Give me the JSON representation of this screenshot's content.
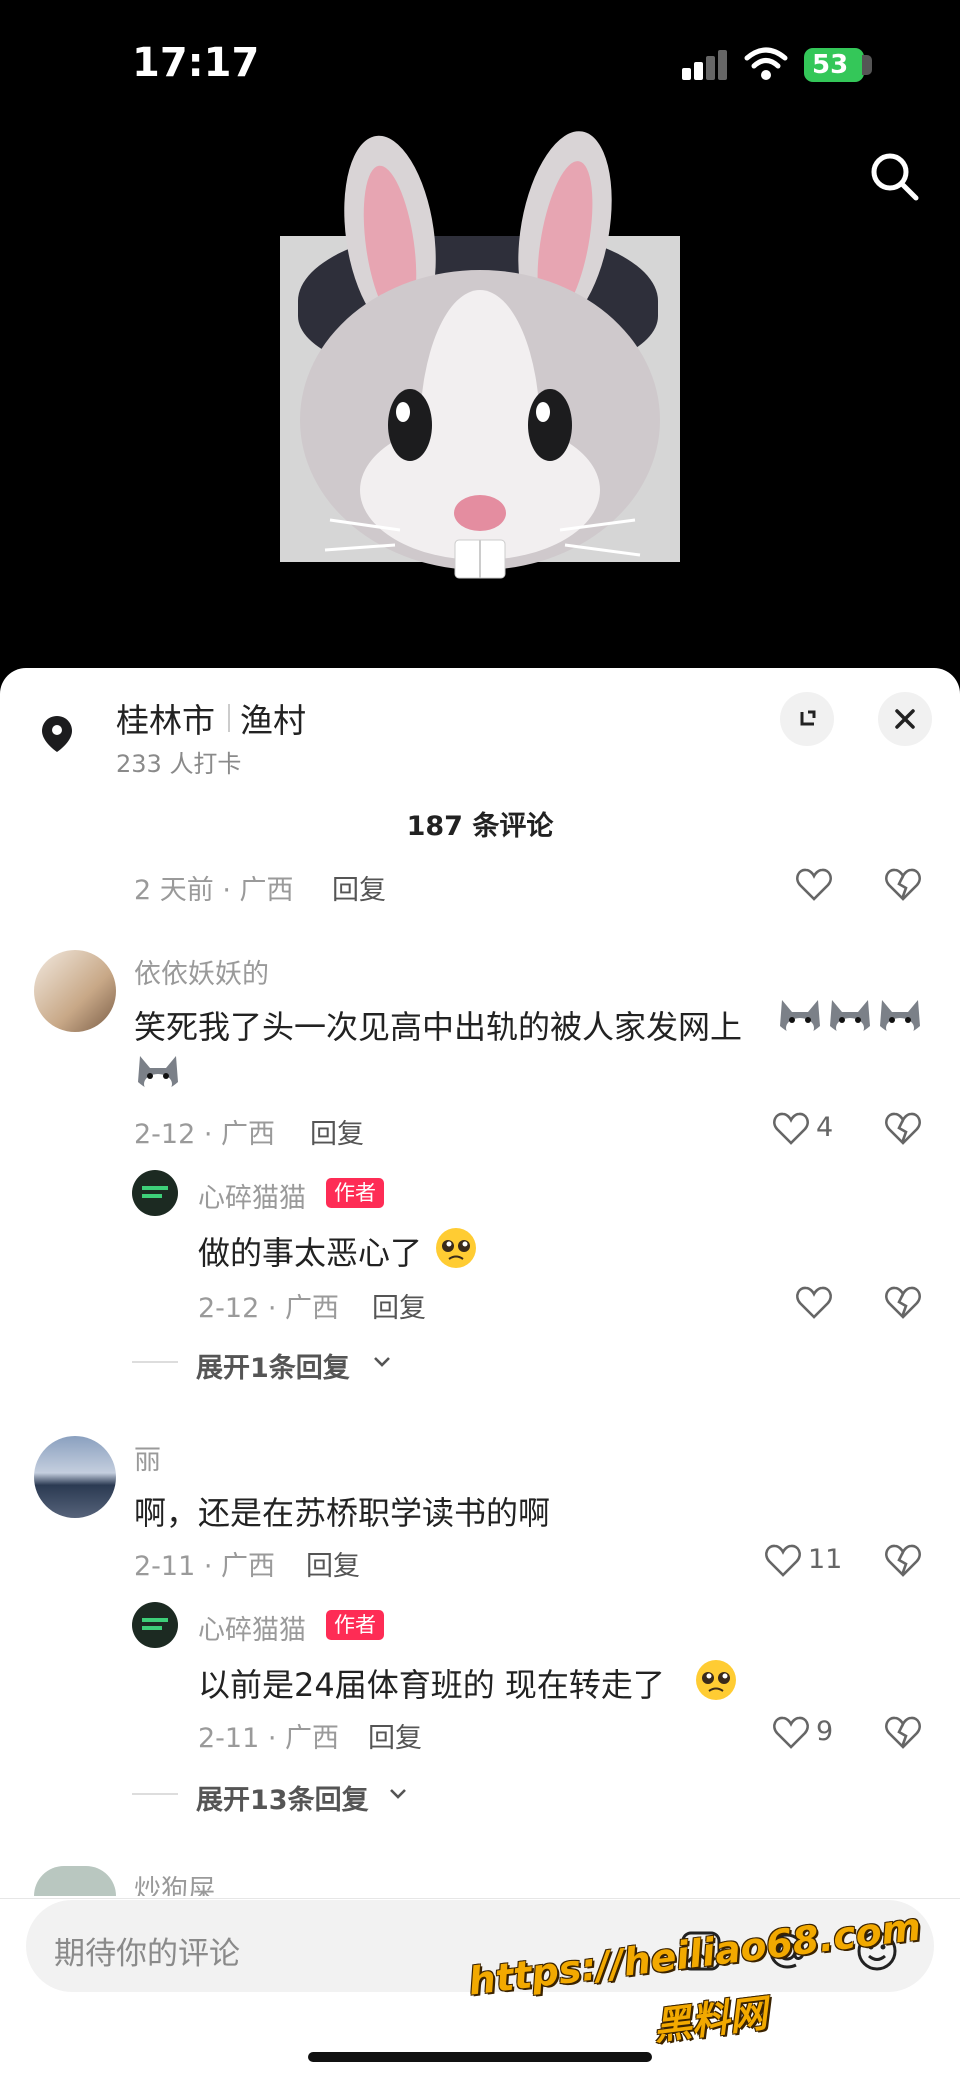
{
  "status_bar": {
    "time": "17:17",
    "battery": "53"
  },
  "location": {
    "city": "桂林市",
    "place": "渔村",
    "checkins": "233 人打卡"
  },
  "comments_count": "187 条评论",
  "prev_comment_meta": {
    "time": "2 天前 · 广西",
    "reply": "回复"
  },
  "comments": [
    {
      "user": "依依妖妖的",
      "text_line1": "笑死我了头一次见高中出轨的被人家发网上",
      "meta": "2-12 · 广西",
      "reply": "回复",
      "likes": "4",
      "author_reply": {
        "user": "心碎猫猫",
        "badge": "作者",
        "text": "做的事太恶心了",
        "meta": "2-12 · 广西",
        "reply": "回复"
      },
      "expand": "展开1条回复"
    },
    {
      "user": "丽",
      "text_line1": "啊，还是在苏桥职学读书的啊",
      "meta": "2-11 · 广西",
      "reply": "回复",
      "likes": "11",
      "author_reply": {
        "user": "心碎猫猫",
        "badge": "作者",
        "text": "以前是24届体育班的 现在转走了",
        "meta": "2-11 · 广西",
        "reply": "回复",
        "likes": "9"
      },
      "expand": "展开13条回复"
    },
    {
      "user": "炒狗屎"
    }
  ],
  "input": {
    "placeholder": "期待你的评论"
  },
  "watermark": {
    "url": "https://heiliao68.com",
    "name": "黑料网"
  },
  "colors": {
    "accent": "#fe2c55",
    "battery": "#34c759",
    "watermark": "#f2a900"
  },
  "icons": [
    "signal-icon",
    "wifi-icon",
    "search-icon",
    "location-pin-icon",
    "minimize-icon",
    "close-icon",
    "heart-icon",
    "broken-heart-icon",
    "chevron-down-icon",
    "image-icon",
    "mention-icon",
    "emoji-icon"
  ]
}
